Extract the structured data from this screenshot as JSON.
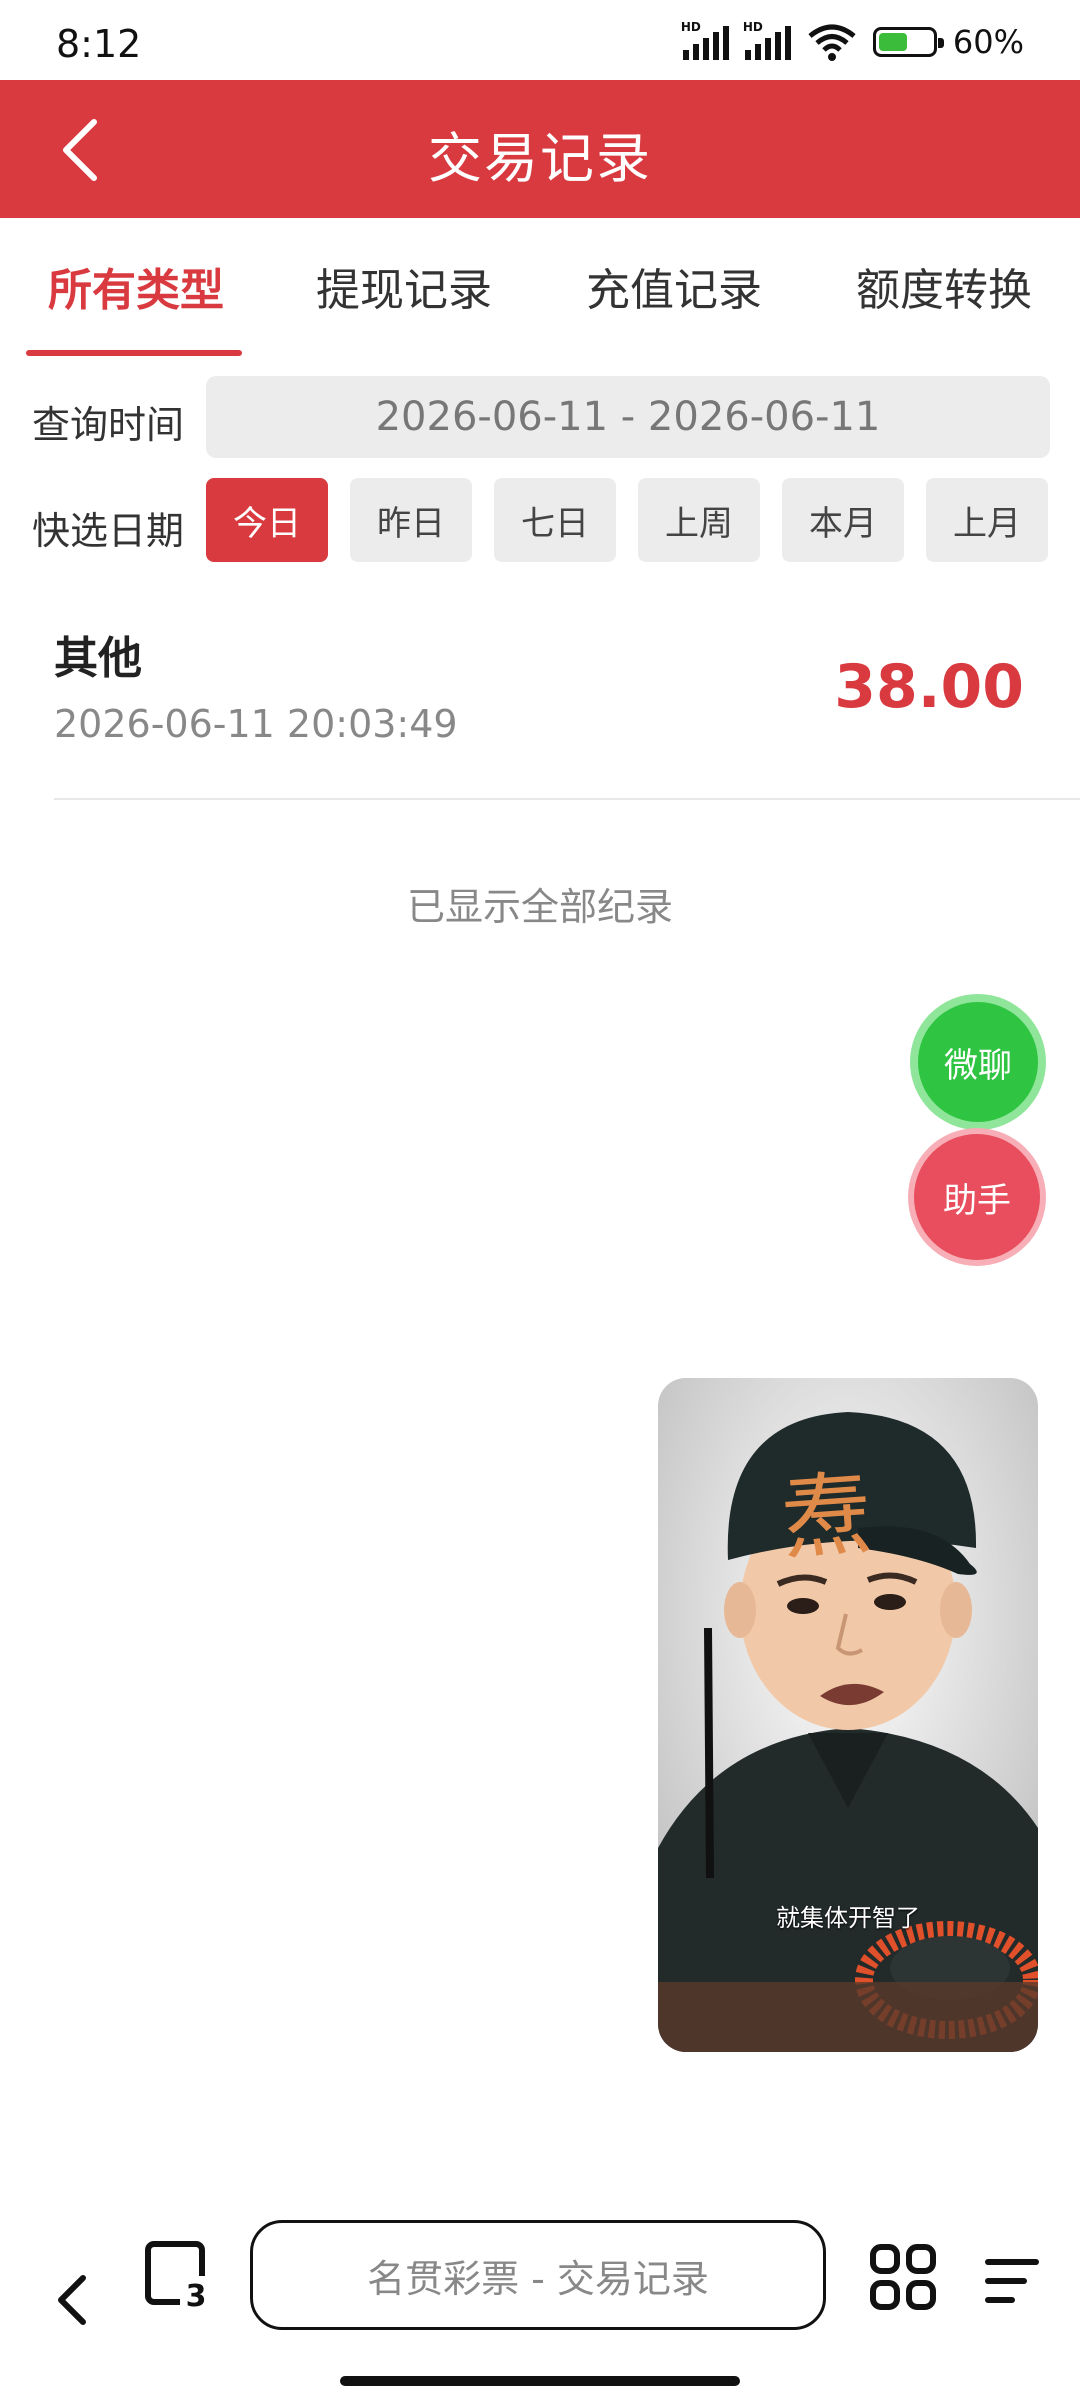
{
  "status_bar": {
    "time": "8:12",
    "battery": "60%",
    "hd_label": "HD"
  },
  "header": {
    "title": "交易记录"
  },
  "tabs": [
    {
      "label": "所有类型",
      "active": true
    },
    {
      "label": "提现记录",
      "active": false
    },
    {
      "label": "充值记录",
      "active": false
    },
    {
      "label": "额度转换",
      "active": false
    }
  ],
  "query": {
    "time_label": "查询时间",
    "date_range": "2026-06-11 - 2026-06-11",
    "quick_label": "快选日期",
    "quick_options": [
      "今日",
      "昨日",
      "七日",
      "上周",
      "本月",
      "上月"
    ],
    "quick_selected": "今日"
  },
  "records": [
    {
      "type": "其他",
      "time": "2026-06-11 20:03:49",
      "amount": "38.00"
    }
  ],
  "list_footer": "已显示全部纪录",
  "floating": {
    "wechat": "微聊",
    "helper": "助手"
  },
  "video": {
    "caption": "就集体开智了",
    "cap_text": "焘"
  },
  "bottom_bar": {
    "address": "名贯彩票 - 交易记录",
    "tab_count": "3"
  },
  "colors": {
    "accent": "#d93a40",
    "wechat_green": "#2fc441",
    "helper_red": "#e84e5d"
  }
}
